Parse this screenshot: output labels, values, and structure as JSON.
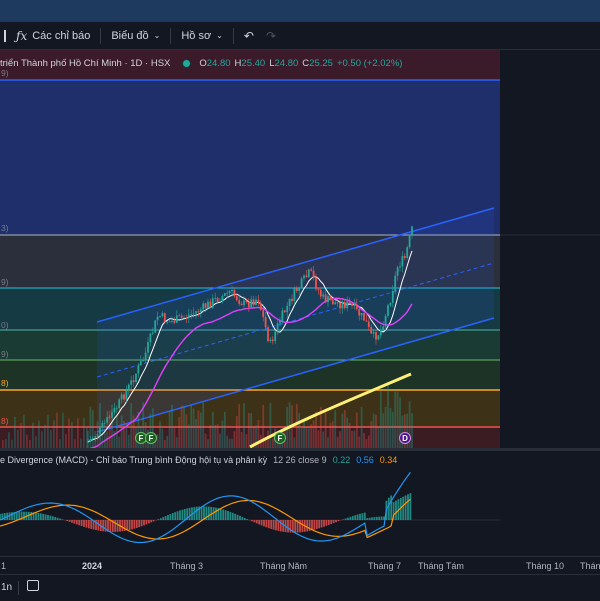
{
  "toolbar": {
    "indicators_label": "Các chỉ báo",
    "chart_label": "Biểu đồ",
    "profile_label": "Hồ sơ",
    "indicators_icon": "function-fx-icon",
    "undo_icon": "undo-icon",
    "redo_icon": "redo-icon",
    "dropdown_icon": "chevron-down-icon"
  },
  "legend": {
    "symbol": "triển Thành phố Hồ Chí Minh · 1D · HSX",
    "open_label": "O",
    "open": "24.80",
    "high_label": "H",
    "high": "25.40",
    "low_label": "L",
    "low": "24.80",
    "close_label": "C",
    "close": "25.25",
    "change": "+0.50 (+2.02%)"
  },
  "price_axis_fragments": [
    "9)",
    "3)",
    "9)",
    "0)",
    "9)",
    "8)",
    "8)"
  ],
  "markers": {
    "f1": "F",
    "f2": "F",
    "f3": "F",
    "d": "D"
  },
  "macd": {
    "title": "e Divergence (MACD) - Chỉ báo Trung bình Động hội tụ và phân kỳ",
    "params": "12 26 close 9",
    "macd_value": "0.22",
    "signal_value": "0.56",
    "hist_value": "0.34"
  },
  "time_axis": {
    "labels": [
      "1",
      "2024",
      "Tháng 3",
      "Tháng Năm",
      "Tháng 7",
      "Tháng Tám",
      "Tháng 10",
      "Tháng"
    ]
  },
  "bottom": {
    "interval_label": "1n",
    "calendar_icon": "calendar-range-icon"
  },
  "colors": {
    "up": "#26a69a",
    "down": "#ef5350",
    "channel": "#2962ff",
    "ma_fast": "#ffffff",
    "ma_mid": "#e040fb",
    "ma_slow": "#fff176",
    "macd_line": "#2196f3",
    "signal_line": "#ff9800"
  }
}
